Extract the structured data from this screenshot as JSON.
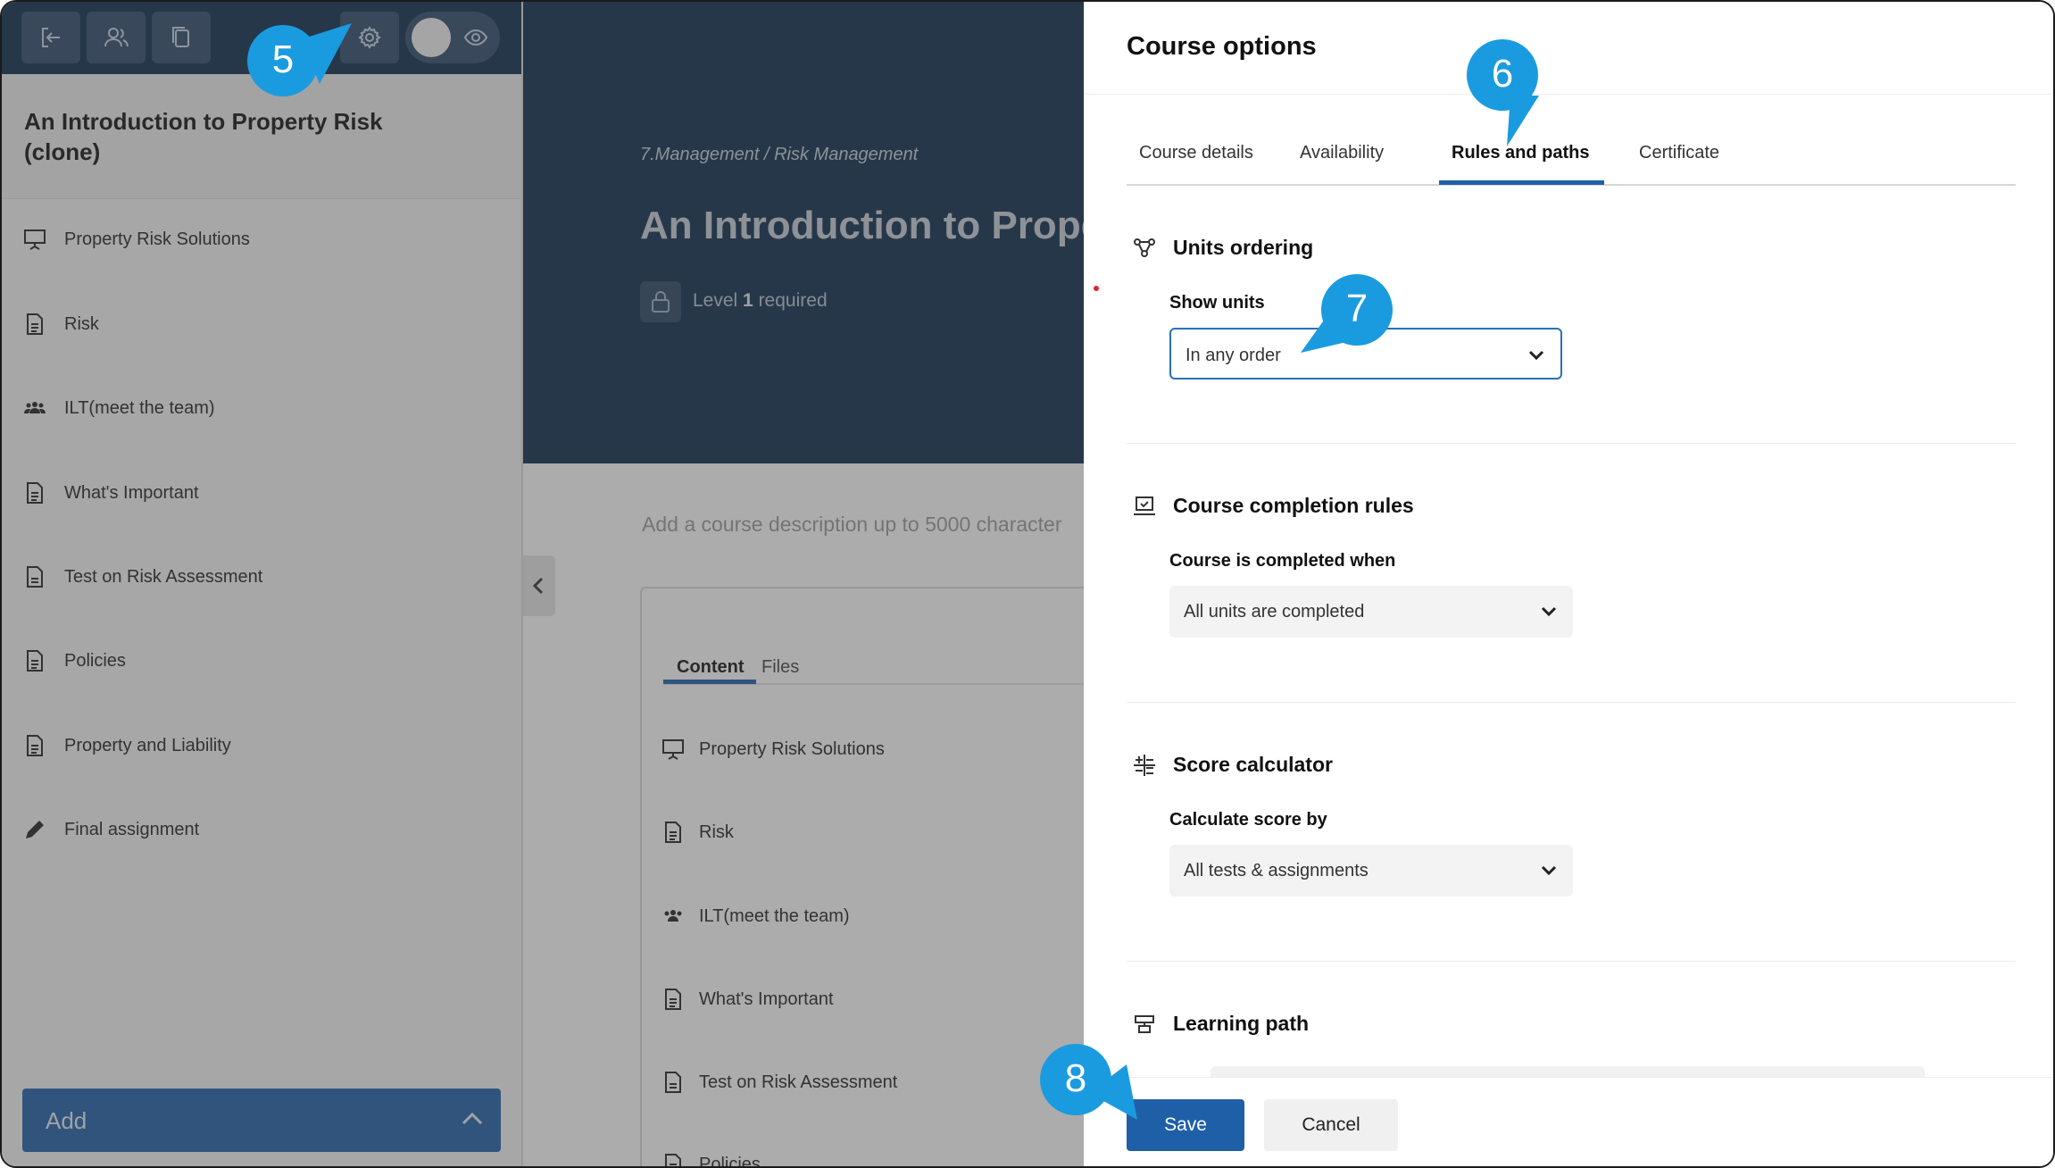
{
  "sidebar": {
    "course_title": "An Introduction to Property Risk (clone)",
    "toolbar_icons": [
      "exit-icon",
      "users-icon",
      "copy-icon",
      "gear-icon",
      "eye-icon"
    ],
    "items": [
      {
        "label": "Property Risk Solutions",
        "icon": "presentation-icon"
      },
      {
        "label": "Risk",
        "icon": "document-icon"
      },
      {
        "label": "ILT(meet the team)",
        "icon": "group-icon"
      },
      {
        "label": "What's Important",
        "icon": "document-icon"
      },
      {
        "label": "Test on Risk Assessment",
        "icon": "test-icon"
      },
      {
        "label": "Policies",
        "icon": "document-icon"
      },
      {
        "label": "Property and Liability",
        "icon": "document-icon"
      },
      {
        "label": "Final assignment",
        "icon": "pencil-icon"
      }
    ],
    "add_label": "Add"
  },
  "main": {
    "breadcrumb": "7.Management / Risk Management",
    "title": "An Introduction to Proper",
    "level_prefix": "Level ",
    "level_value": "1",
    "level_suffix": " required",
    "description_placeholder": "Add a course description up to 5000 character",
    "tabs": [
      {
        "label": "Content"
      },
      {
        "label": "Files"
      }
    ],
    "content_items": [
      {
        "label": "Property Risk Solutions",
        "icon": "presentation-icon"
      },
      {
        "label": "Risk",
        "icon": "document-icon"
      },
      {
        "label": "ILT(meet the team)",
        "icon": "group-icon"
      },
      {
        "label": "What's Important",
        "icon": "document-icon"
      },
      {
        "label": "Test on Risk Assessment",
        "icon": "test-icon"
      },
      {
        "label": "Policies",
        "icon": "document-icon"
      }
    ]
  },
  "drawer": {
    "title": "Course options",
    "tabs": [
      {
        "label": "Course details"
      },
      {
        "label": "Availability"
      },
      {
        "label": "Rules and paths"
      },
      {
        "label": "Certificate"
      }
    ],
    "active_tab": "Rules and paths",
    "units_ordering": {
      "title": "Units ordering",
      "field_label": "Show units",
      "value": "In any order"
    },
    "completion": {
      "title": "Course completion rules",
      "field_label": "Course is completed when",
      "value": "All units are completed"
    },
    "score": {
      "title": "Score calculator",
      "field_label": "Calculate score by",
      "value": "All tests & assignments"
    },
    "learning_path": {
      "title": "Learning path"
    },
    "save_label": "Save",
    "cancel_label": "Cancel"
  },
  "callouts": [
    "5",
    "6",
    "7",
    "8"
  ],
  "colors": {
    "brand_navy": "#0c2a4c",
    "primary_blue": "#1f5fa8",
    "callout_blue": "#1a9be0"
  }
}
